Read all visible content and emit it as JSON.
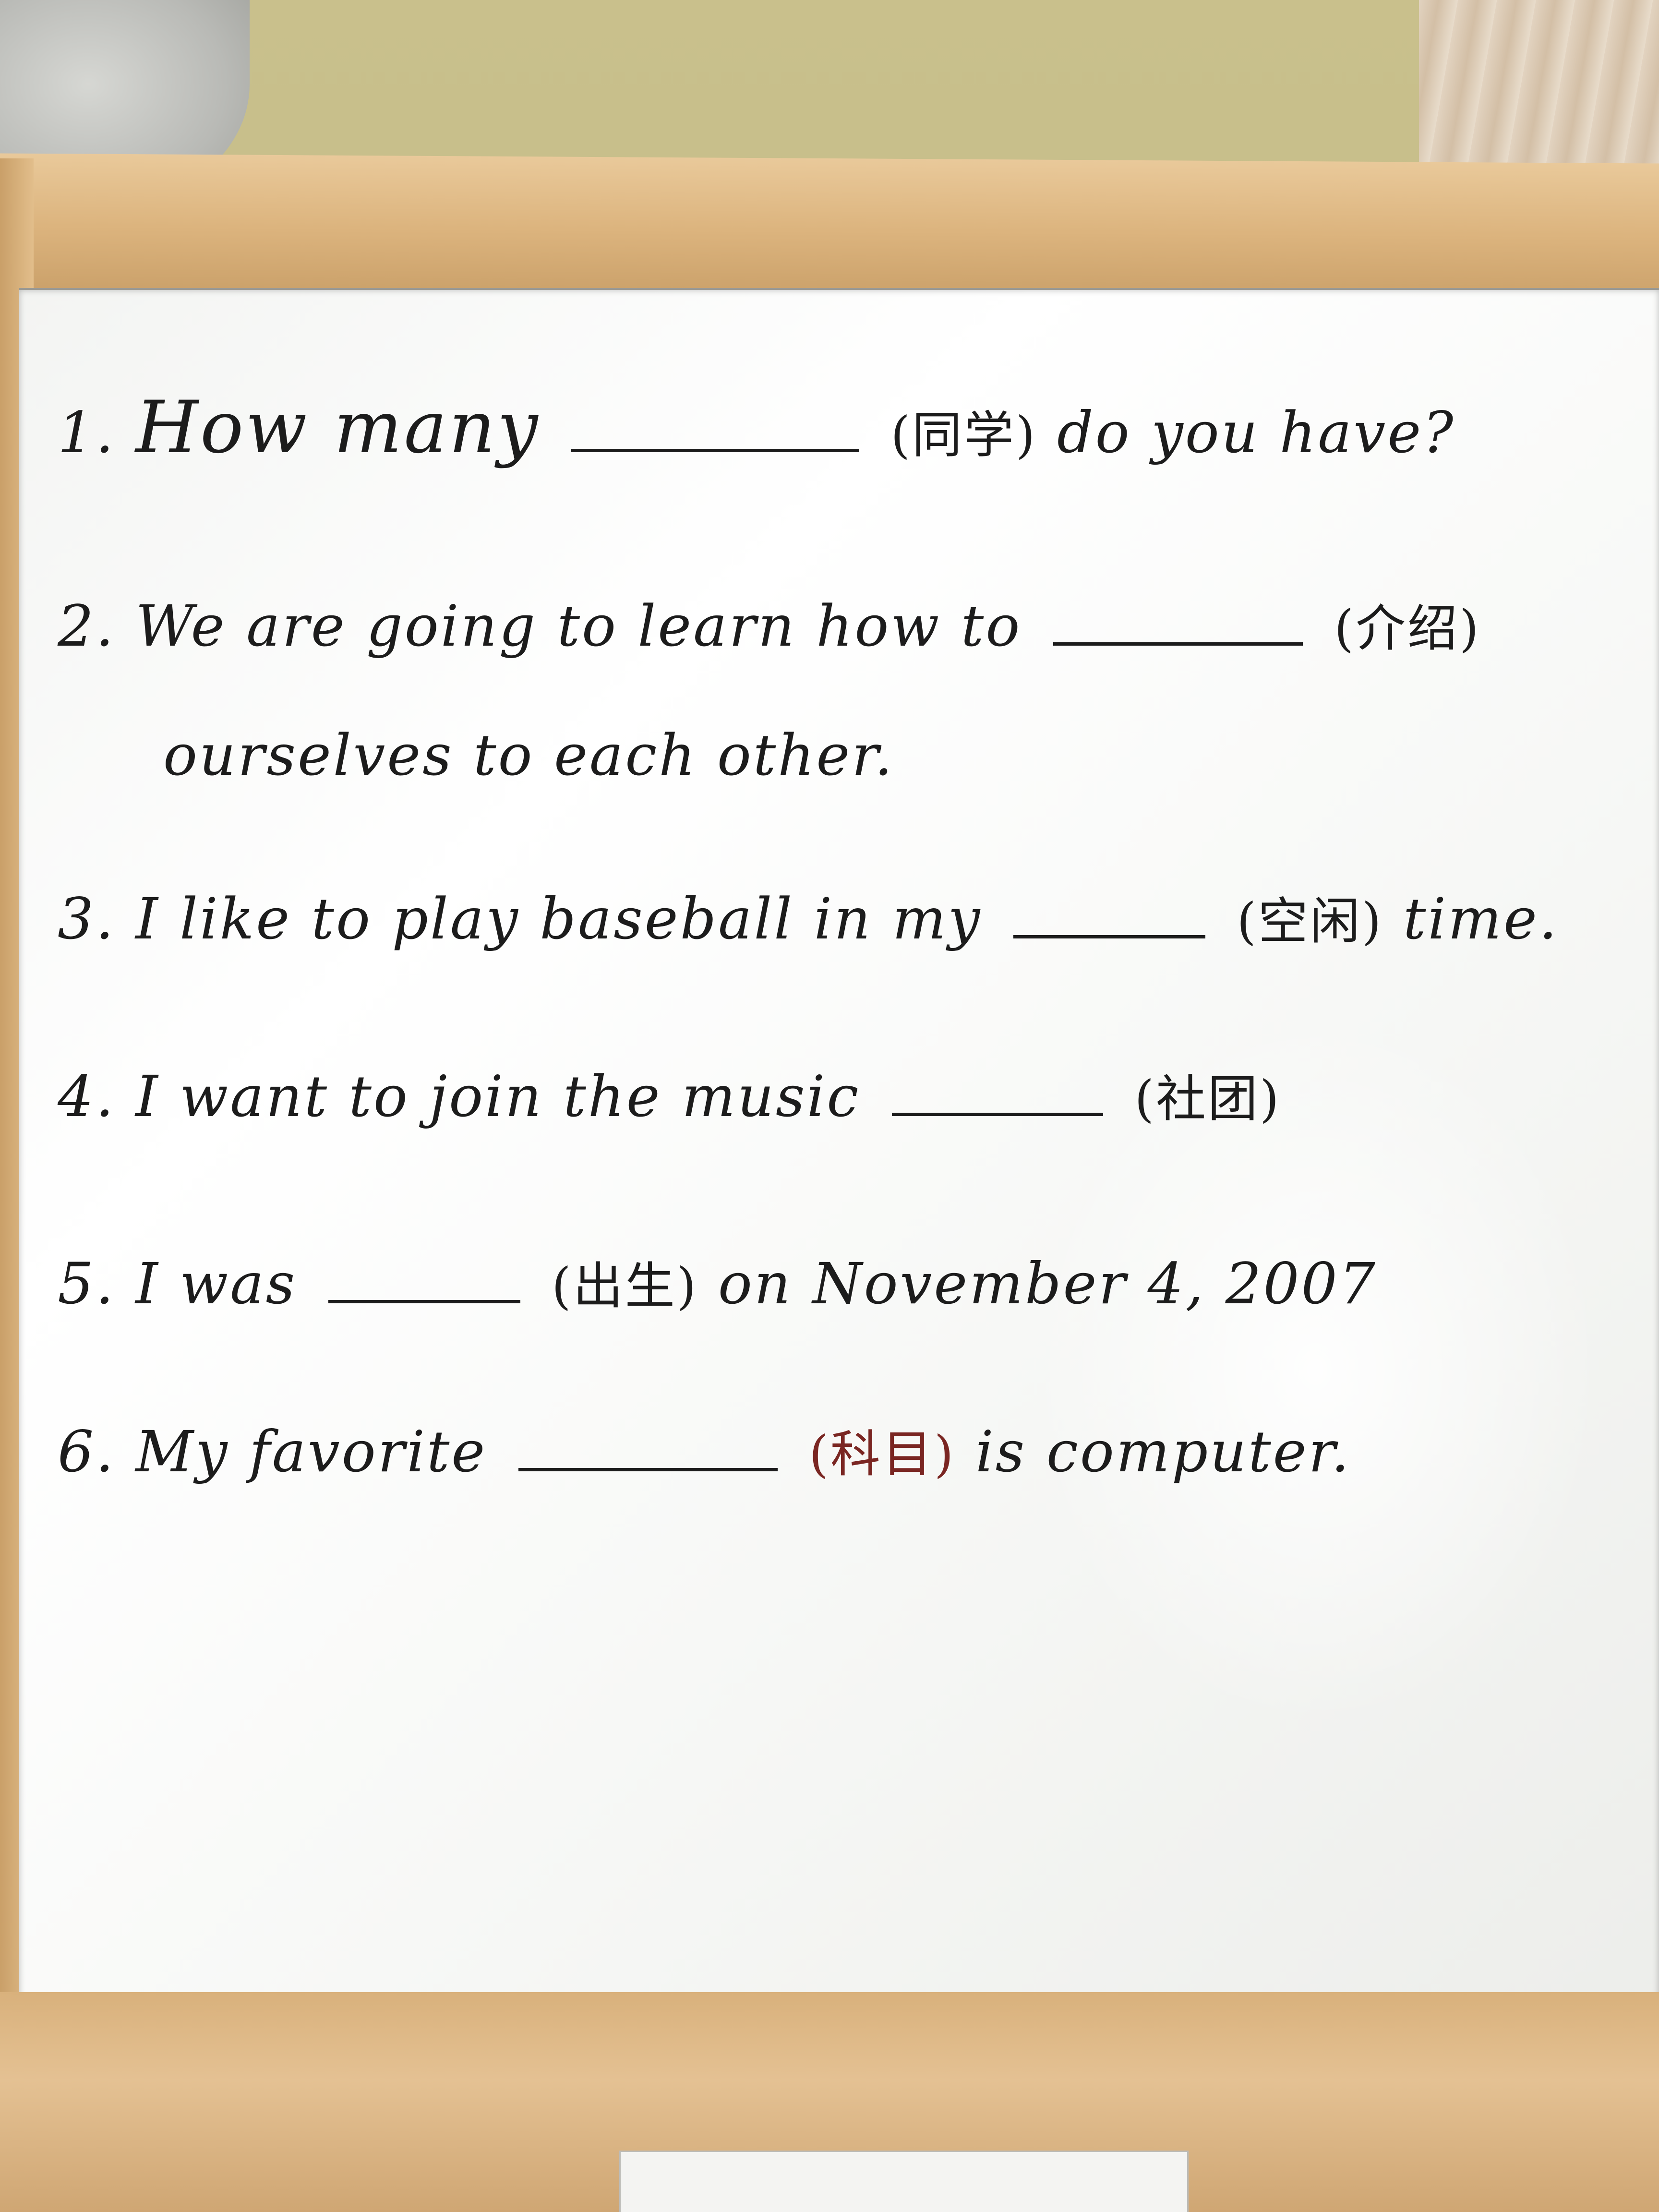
{
  "board": {
    "q1": {
      "num": "1.",
      "pre": "How many",
      "hint": "(同学)",
      "post": "do you have?"
    },
    "q2": {
      "num": "2.",
      "pre": "We are going to learn how to",
      "hint": "(介绍)",
      "cont": "ourselves to each other."
    },
    "q3": {
      "num": "3.",
      "pre": "I like to play baseball in my",
      "hint": "(空闲)",
      "post": "time."
    },
    "q4": {
      "num": "4.",
      "pre": "I want to join the music",
      "hint": "(社团)"
    },
    "q5": {
      "num": "5.",
      "pre": "I was",
      "hint": "(出生)",
      "post": "on November 4, 2007"
    },
    "q6": {
      "num": "6.",
      "pre": "My favorite",
      "hint": "(科目)",
      "post": "is computer."
    }
  },
  "colors": {
    "marker": "#1c1c1c",
    "red_marker": "#7a2622",
    "board": "#f6f7f5",
    "wood": "#dcb47e",
    "wall": "#c3b985"
  }
}
